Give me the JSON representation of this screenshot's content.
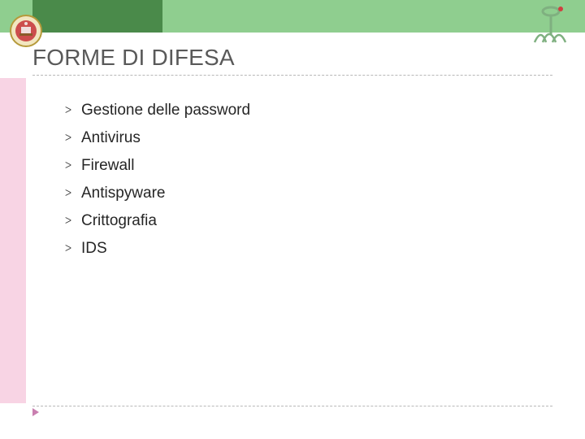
{
  "title": "FORME DI DIFESA",
  "items": [
    "Gestione delle password",
    "Antivirus",
    "Firewall",
    "Antispyware",
    "Crittografia",
    "IDS"
  ],
  "colors": {
    "band": "#8fce8f",
    "bandDark": "#4a8a4a",
    "sidebar": "#f8d4e4",
    "divider": "#b8b8b8",
    "title": "#595959",
    "foot": "#c97fb0"
  }
}
